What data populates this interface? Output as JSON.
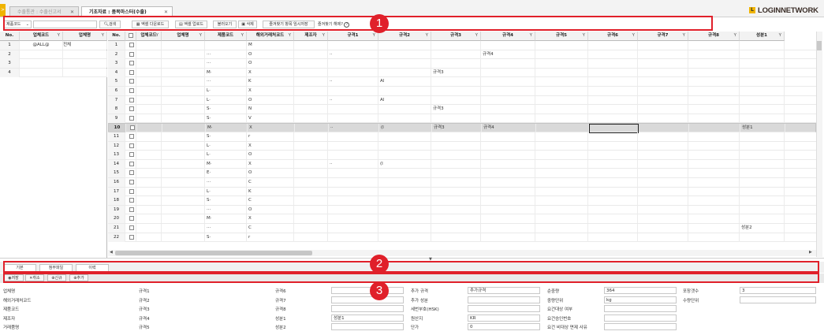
{
  "tabs": [
    {
      "label": "수출통관 : 수출신고서",
      "active": false
    },
    {
      "label": "기초자료 : 품목마스터(수출)",
      "active": true
    }
  ],
  "tab_close": "✕",
  "side_toggle": ">",
  "logo": {
    "mark": "L",
    "text": "LOGINNETWORK"
  },
  "toolbar": {
    "field_select": "제품코드",
    "search_label": "검색",
    "excel_download": "엑셀 다운로드",
    "excel_upload": "엑셀 업로드",
    "import": "불러오기",
    "delete": "삭제",
    "favorites_save": "즐겨찾기 항목 임시저장",
    "favorites_help": "즐겨찾기 해제?"
  },
  "callouts": [
    "1",
    "2",
    "3"
  ],
  "left_grid": {
    "columns": [
      "No.",
      "업체코드",
      "업체명"
    ],
    "rows": [
      {
        "no": "1",
        "code": "@ALL@",
        "name": "전체"
      },
      {
        "no": "2",
        "code": "",
        "name": ""
      },
      {
        "no": "3",
        "code": "",
        "name": ""
      },
      {
        "no": "4",
        "code": "",
        "name": ""
      }
    ]
  },
  "main_grid": {
    "columns": [
      "No.",
      "",
      "업체코드",
      "업체명",
      "제품코드",
      "해외거래처코드",
      "제조자",
      "규격1",
      "규격2",
      "규격3",
      "규격4",
      "규격5",
      "규격6",
      "규격7",
      "규격8",
      "성분1"
    ],
    "rows": [
      {
        "no": "1",
        "c": [
          "",
          "",
          "",
          "M",
          "",
          "",
          "",
          "",
          "",
          "",
          "",
          "",
          "",
          ""
        ]
      },
      {
        "no": "2",
        "c": [
          "",
          "",
          "···",
          "O",
          "",
          "··",
          "",
          "",
          "규격4",
          "",
          "",
          "",
          "",
          ""
        ]
      },
      {
        "no": "3",
        "c": [
          "",
          "",
          "···",
          "O",
          "",
          "",
          "",
          "",
          "",
          "",
          "",
          "",
          "",
          ""
        ]
      },
      {
        "no": "4",
        "c": [
          "",
          "",
          "M·",
          "X",
          "",
          "",
          "",
          "규격3",
          "",
          "",
          "",
          "",
          "",
          ""
        ]
      },
      {
        "no": "5",
        "c": [
          "",
          "",
          "···",
          "K",
          "",
          "··",
          "Al",
          "",
          "",
          "",
          "",
          "",
          "",
          ""
        ]
      },
      {
        "no": "6",
        "c": [
          "",
          "",
          "L·",
          "X",
          "",
          "",
          "",
          "",
          "",
          "",
          "",
          "",
          "",
          ""
        ]
      },
      {
        "no": "7",
        "c": [
          "",
          "",
          "L·",
          "O",
          "",
          "··",
          "Al",
          "",
          "",
          "",
          "",
          "",
          "",
          ""
        ]
      },
      {
        "no": "8",
        "c": [
          "",
          "",
          "S·",
          "N",
          "",
          "",
          "",
          "규격3",
          "",
          "",
          "",
          "",
          "",
          ""
        ]
      },
      {
        "no": "9",
        "c": [
          "",
          "",
          "S·",
          "V",
          "",
          "",
          "",
          "",
          "",
          "",
          "",
          "",
          "",
          ""
        ]
      },
      {
        "no": "10",
        "c": [
          "",
          "",
          "M·",
          "X",
          "",
          "··",
          "(I",
          "규격3",
          "규격4",
          "",
          "",
          "",
          "",
          "성분1"
        ]
      },
      {
        "no": "11",
        "c": [
          "",
          "",
          "S·",
          "r",
          "",
          "",
          "",
          "",
          "",
          "",
          "",
          "",
          "",
          ""
        ]
      },
      {
        "no": "12",
        "c": [
          "",
          "",
          "L·",
          "X",
          "",
          "",
          "",
          "",
          "",
          "",
          "",
          "",
          "",
          ""
        ]
      },
      {
        "no": "13",
        "c": [
          "",
          "",
          "L·",
          "O",
          "",
          "",
          "",
          "",
          "",
          "",
          "",
          "",
          "",
          ""
        ]
      },
      {
        "no": "14",
        "c": [
          "",
          "",
          "M·",
          "X",
          "",
          "··",
          "(I",
          "",
          "",
          "",
          "",
          "",
          "",
          ""
        ]
      },
      {
        "no": "15",
        "c": [
          "",
          "",
          "E·",
          "O",
          "",
          "",
          "",
          "",
          "",
          "",
          "",
          "",
          "",
          ""
        ]
      },
      {
        "no": "16",
        "c": [
          "",
          "",
          "···",
          "C",
          "",
          "",
          "",
          "",
          "",
          "",
          "",
          "",
          "",
          ""
        ]
      },
      {
        "no": "17",
        "c": [
          "",
          "",
          "L·",
          "K",
          "",
          "",
          "",
          "",
          "",
          "",
          "",
          "",
          "",
          ""
        ]
      },
      {
        "no": "18",
        "c": [
          "",
          "",
          "S·",
          "C",
          "",
          "",
          "",
          "",
          "",
          "",
          "",
          "",
          "",
          ""
        ]
      },
      {
        "no": "19",
        "c": [
          "",
          "",
          "···",
          "O",
          "",
          "",
          "",
          "",
          "",
          "",
          "",
          "",
          "",
          ""
        ]
      },
      {
        "no": "20",
        "c": [
          "",
          "",
          "M·",
          "X",
          "",
          "",
          "",
          "",
          "",
          "",
          "",
          "",
          "",
          ""
        ]
      },
      {
        "no": "21",
        "c": [
          "",
          "",
          "···",
          "C",
          "",
          "",
          "",
          "",
          "",
          "",
          "",
          "",
          "",
          "성분2"
        ]
      },
      {
        "no": "22",
        "c": [
          "",
          "",
          "S·",
          "r",
          "",
          "",
          "",
          "",
          "",
          "",
          "",
          "",
          "",
          ""
        ]
      }
    ]
  },
  "sub_tabs": [
    "기본",
    "첨부파일",
    "이력"
  ],
  "actions": [
    "저장",
    "취소",
    "신규",
    "추가"
  ],
  "form": {
    "col1": [
      {
        "label": "업체명",
        "value": ""
      },
      {
        "label": "해외거래처코드",
        "value": ""
      },
      {
        "label": "제품코드",
        "value": ""
      },
      {
        "label": "제조자",
        "value": ""
      },
      {
        "label": "거래품명",
        "value": ""
      }
    ],
    "col2": [
      {
        "label": "규격1",
        "value": ""
      },
      {
        "label": "규격2",
        "value": ""
      },
      {
        "label": "규격3",
        "value": ""
      },
      {
        "label": "규격4",
        "value": ""
      },
      {
        "label": "규격5",
        "value": ""
      }
    ],
    "col3": [
      {
        "label": "규격6",
        "value": ""
      },
      {
        "label": "규격7",
        "value": ""
      },
      {
        "label": "규격8",
        "value": ""
      },
      {
        "label": "성분1",
        "value": "성분1"
      },
      {
        "label": "성분2",
        "value": ""
      }
    ],
    "col4": [
      {
        "label": "추가 규격",
        "value": "추가규격"
      },
      {
        "label": "추가 성분",
        "value": ""
      },
      {
        "label": "세번부호(HSK)",
        "value": ""
      },
      {
        "label": "원산지",
        "value": "KR"
      },
      {
        "label": "단가",
        "value": "0"
      }
    ],
    "col5": [
      {
        "label": "순중량",
        "value": "364"
      },
      {
        "label": "중량단위",
        "value": "kg"
      },
      {
        "label": "요건대상 여부",
        "value": ""
      },
      {
        "label": "요건승인번호",
        "value": ""
      },
      {
        "label": "요건 비대상 면제 사유",
        "value": ""
      }
    ],
    "col6": [
      {
        "label": "포장갯수",
        "value": "3"
      },
      {
        "label": "수량단위",
        "value": ""
      }
    ]
  }
}
